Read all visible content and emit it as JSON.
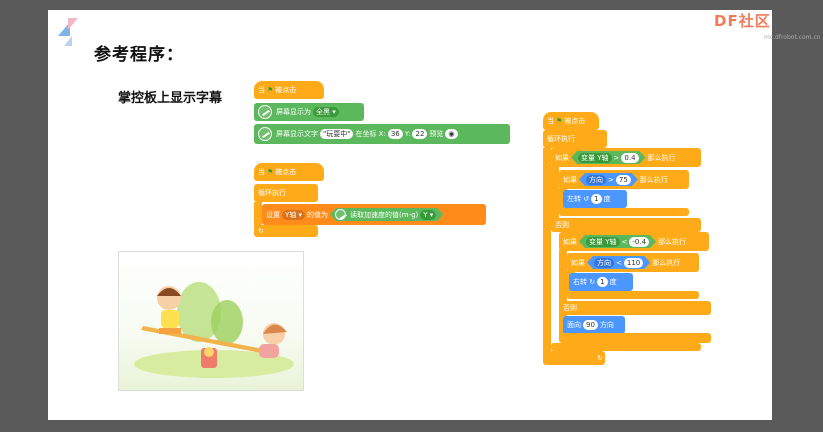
{
  "slide": {
    "title": "参考程序：",
    "subtitle": "掌控板上显示字幕",
    "brand": "DF社区",
    "brand_sub": "mc.dfrobot.com.cn"
  },
  "colors": {
    "control": "#ffab19",
    "display": "#5cb85c",
    "motion": "#4c97ff",
    "brand": "#f07a5a"
  },
  "script1": {
    "hat_prefix": "当",
    "hat_suffix": "被点击",
    "show_label": "屏幕显示为",
    "show_value": "全黑 ▾",
    "text_label": "屏幕显示文字",
    "text_value": "\"玩耍中\"",
    "text_at": "在坐标 X:",
    "x_value": "36",
    "y_label": "Y:",
    "y_value": "22",
    "preview": "预览",
    "eye_icon": "eye-icon"
  },
  "script2": {
    "hat_prefix": "当",
    "hat_suffix": "被点击",
    "loop": "循环执行",
    "set_label": "设置",
    "var_name": "Y轴 ▾",
    "value_of": "的值为",
    "accel_label": "读取加速度的值(m-g)",
    "accel_axis": "Y ▾"
  },
  "script3": {
    "hat_prefix": "当",
    "hat_suffix": "被点击",
    "loop": "循环执行",
    "if1": "如果",
    "var1": "变量 Y轴",
    "op1": ">",
    "val1": "0.4",
    "then1": "那么执行",
    "if2": "如果",
    "dir1": "方向",
    "op2": ">",
    "val2": "75",
    "then2": "那么执行",
    "turn_left": "左转",
    "left_deg": "1",
    "deg1": "度",
    "else1": "否则",
    "if3": "如果",
    "var2": "变量 Y轴",
    "op3": "<",
    "val3": "-0.4",
    "then3": "那么执行",
    "if4": "如果",
    "dir2": "方向",
    "op4": "<",
    "val4": "110",
    "then4": "那么执行",
    "turn_right": "右转",
    "right_deg": "1",
    "deg2": "度",
    "else2": "否则",
    "face": "面向",
    "face_val": "90",
    "face_dir": "方向"
  }
}
